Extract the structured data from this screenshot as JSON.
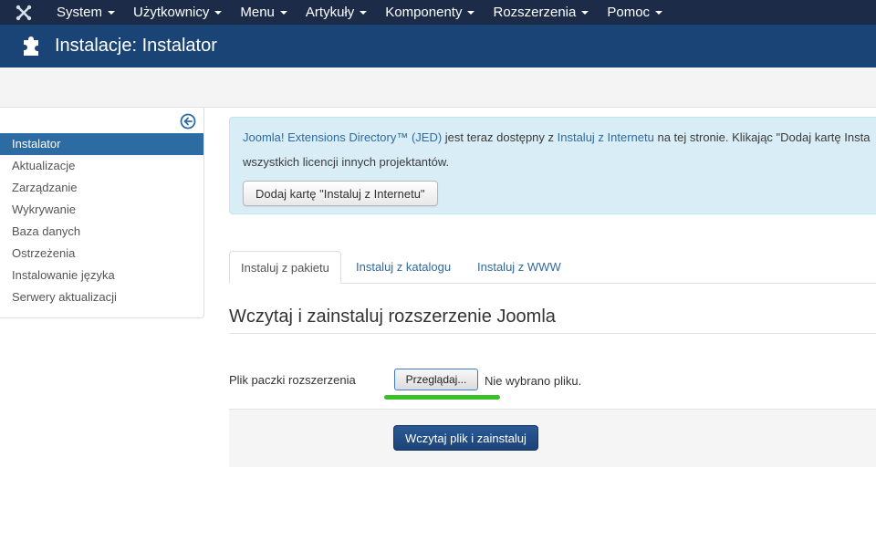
{
  "topbar": {
    "logo_icon": "joomla-logo-icon",
    "menu": [
      {
        "label": "System"
      },
      {
        "label": "Użytkownicy"
      },
      {
        "label": "Menu"
      },
      {
        "label": "Artykuły"
      },
      {
        "label": "Komponenty"
      },
      {
        "label": "Rozszerzenia"
      },
      {
        "label": "Pomoc"
      }
    ]
  },
  "header": {
    "icon": "puzzle-icon",
    "title": "Instalacje: Instalator"
  },
  "sidebar": {
    "toggle_icon": "collapse-left-icon",
    "items": [
      {
        "label": "Instalator",
        "active": true
      },
      {
        "label": "Aktualizacje"
      },
      {
        "label": "Zarządzanie"
      },
      {
        "label": "Wykrywanie"
      },
      {
        "label": "Baza danych"
      },
      {
        "label": "Ostrzeżenia"
      },
      {
        "label": "Instalowanie języka"
      },
      {
        "label": "Serwery aktualizacji"
      }
    ]
  },
  "alert": {
    "jed_link": "Joomla! Extensions Directory™ (JED)",
    "text1": " jest teraz dostępny z ",
    "install_web_link": "Instaluj z Internetu",
    "text2": " na tej stronie.  Klikając \"Dodaj kartę Insta",
    "line2": "wszystkich licencji innych projektantów.",
    "button": "Dodaj kartę \"Instaluj z Internetu\""
  },
  "tabs": [
    {
      "label": "Instaluj z pakietu",
      "active": true
    },
    {
      "label": "Instaluj z katalogu"
    },
    {
      "label": "Instaluj z WWW"
    }
  ],
  "upload": {
    "section_title": "Wczytaj i zainstaluj rozszerzenie Joomla",
    "field_label": "Plik paczki rozszerzenia",
    "browse_button": "Przeglądaj...",
    "no_file": "Nie wybrano pliku.",
    "submit_button": "Wczytaj plik i zainstaluj"
  },
  "colors": {
    "topbar": "#1b2b48",
    "header": "#1b4476",
    "active_item": "#2d6ca2",
    "alert_bg": "#d9edf7",
    "link": "#2f6aa0",
    "highlight_mark": "#3cc02a"
  }
}
